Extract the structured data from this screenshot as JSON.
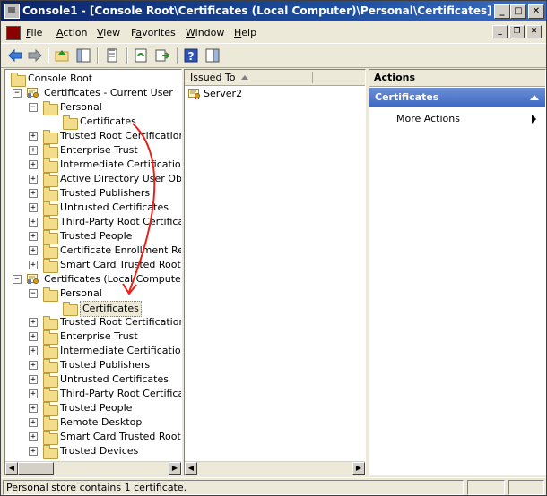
{
  "window": {
    "title": "Console1 - [Console Root\\Certificates (Local Computer)\\Personal\\Certificates]",
    "min_glyph": "_",
    "max_glyph": "□",
    "close_glyph": "✕"
  },
  "menu": {
    "items": [
      {
        "first": "F",
        "rest": "ile"
      },
      {
        "first": "A",
        "rest": "ction"
      },
      {
        "first": "V",
        "rest": "iew"
      },
      {
        "first": "Fav",
        "rest": "orites",
        "underline_index": 0
      },
      {
        "first": "W",
        "rest": "indow"
      },
      {
        "first": "H",
        "rest": "elp"
      }
    ],
    "labels": [
      "File",
      "Action",
      "View",
      "Favorites",
      "Window",
      "Help"
    ]
  },
  "tree": {
    "nodes": [
      {
        "label": "Console Root",
        "type": "folder",
        "level": 0,
        "expander": ""
      },
      {
        "label": "Certificates - Current User",
        "type": "cert",
        "level": 1,
        "expander": "−"
      },
      {
        "label": "Personal",
        "type": "folder",
        "level": 2,
        "expander": "−"
      },
      {
        "label": "Certificates",
        "type": "folder",
        "level": 3,
        "expander": ""
      },
      {
        "label": "Trusted Root Certification Authorities",
        "type": "folder",
        "level": 2,
        "expander": "+"
      },
      {
        "label": "Enterprise Trust",
        "type": "folder",
        "level": 2,
        "expander": "+"
      },
      {
        "label": "Intermediate Certification Authorities",
        "type": "folder",
        "level": 2,
        "expander": "+"
      },
      {
        "label": "Active Directory User Object",
        "type": "folder",
        "level": 2,
        "expander": "+"
      },
      {
        "label": "Trusted Publishers",
        "type": "folder",
        "level": 2,
        "expander": "+"
      },
      {
        "label": "Untrusted Certificates",
        "type": "folder",
        "level": 2,
        "expander": "+"
      },
      {
        "label": "Third-Party Root Certification Authorities",
        "type": "folder",
        "level": 2,
        "expander": "+"
      },
      {
        "label": "Trusted People",
        "type": "folder",
        "level": 2,
        "expander": "+"
      },
      {
        "label": "Certificate Enrollment Requests",
        "type": "folder",
        "level": 2,
        "expander": "+"
      },
      {
        "label": "Smart Card Trusted Roots",
        "type": "folder",
        "level": 2,
        "expander": "+"
      },
      {
        "label": "Certificates (Local Computer)",
        "type": "cert",
        "level": 1,
        "expander": "−"
      },
      {
        "label": "Personal",
        "type": "folder",
        "level": 2,
        "expander": "−"
      },
      {
        "label": "Certificates",
        "type": "folder",
        "level": 3,
        "expander": "",
        "selected": true
      },
      {
        "label": "Trusted Root Certification Authorities",
        "type": "folder",
        "level": 2,
        "expander": "+"
      },
      {
        "label": "Enterprise Trust",
        "type": "folder",
        "level": 2,
        "expander": "+"
      },
      {
        "label": "Intermediate Certification Authorities",
        "type": "folder",
        "level": 2,
        "expander": "+"
      },
      {
        "label": "Trusted Publishers",
        "type": "folder",
        "level": 2,
        "expander": "+"
      },
      {
        "label": "Untrusted Certificates",
        "type": "folder",
        "level": 2,
        "expander": "+"
      },
      {
        "label": "Third-Party Root Certification Authorities",
        "type": "folder",
        "level": 2,
        "expander": "+"
      },
      {
        "label": "Trusted People",
        "type": "folder",
        "level": 2,
        "expander": "+"
      },
      {
        "label": "Remote Desktop",
        "type": "folder",
        "level": 2,
        "expander": "+"
      },
      {
        "label": "Smart Card Trusted Roots",
        "type": "folder",
        "level": 2,
        "expander": "+"
      },
      {
        "label": "Trusted Devices",
        "type": "folder",
        "level": 2,
        "expander": "+"
      }
    ]
  },
  "list": {
    "column_header": "Issued To",
    "items": [
      "Server2"
    ]
  },
  "actions": {
    "header": "Actions",
    "section": "Certificates",
    "more": "More Actions"
  },
  "status": {
    "text": "Personal store contains 1 certificate."
  },
  "colors": {
    "title_bar": "#0a246a",
    "annotation": "#e8221a",
    "actions_section": "#3c66c2"
  },
  "icons": [
    "mmc-icon",
    "back-icon",
    "forward-icon",
    "up-folder-icon",
    "show-hide-tree-icon",
    "export-list-icon",
    "refresh-icon",
    "export-icon",
    "help-icon",
    "properties-icon"
  ]
}
